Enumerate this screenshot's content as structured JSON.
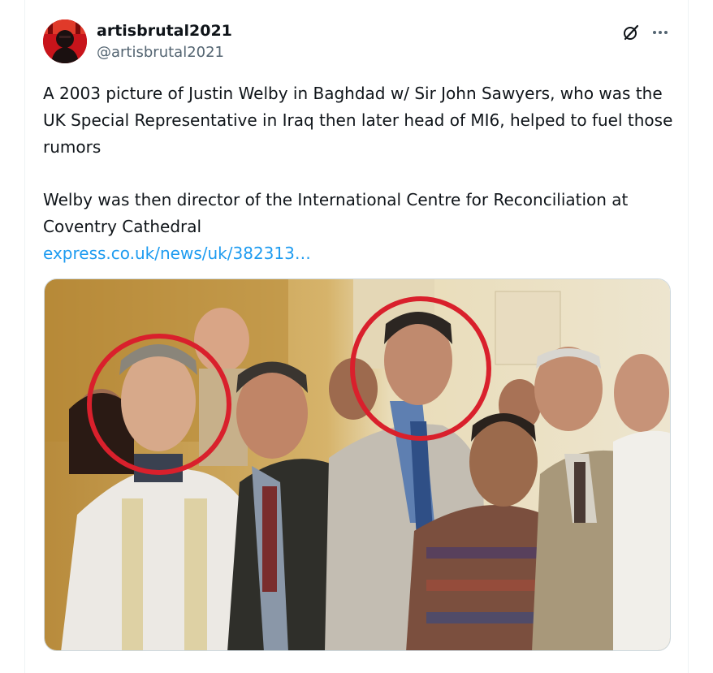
{
  "post": {
    "author": {
      "display_name": "artisbrutal2021",
      "handle": "@artisbrutal2021"
    },
    "text_paragraph_1": "A 2003 picture of Justin Welby in Baghdad w/ Sir John Sawyers, who was the UK Special Representative in Iraq then later head of MI6, helped to fuel those rumors",
    "text_paragraph_2": "Welby was then director of the International Centre for Reconciliation at Coventry Cathedral",
    "link_text": "express.co.uk/news/uk/382313…",
    "actions": {
      "grok_icon": "grok-icon",
      "more_icon": "more-icon"
    },
    "colors": {
      "link": "#1d9bf0",
      "text": "#0f1419",
      "secondary": "#536471",
      "highlight_circle": "#d9202c"
    }
  }
}
